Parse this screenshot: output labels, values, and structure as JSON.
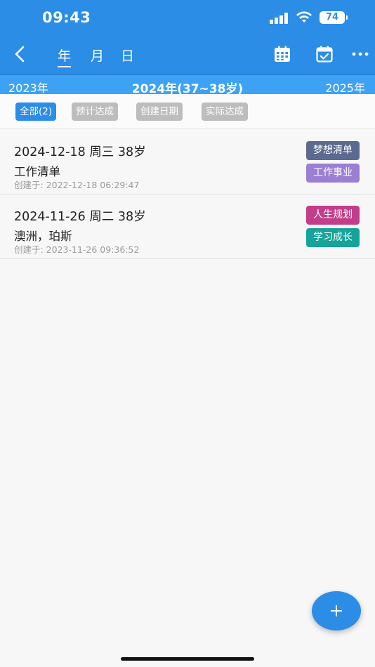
{
  "status": {
    "time": "09:43",
    "battery": "74"
  },
  "nav": {
    "tabs": [
      {
        "label": "年"
      },
      {
        "label": "月"
      },
      {
        "label": "日"
      }
    ],
    "active_tab": 0,
    "icons": [
      "back-icon",
      "calendar-grid-icon",
      "calendar-check-icon",
      "more-icon"
    ]
  },
  "yearbar": {
    "prev": "2023年",
    "current": "2024年(37~38岁)",
    "next": "2025年"
  },
  "filters": [
    {
      "label": "全部(2)",
      "active": true
    },
    {
      "label": "预计达成",
      "active": false
    },
    {
      "label": "创建日期",
      "active": false
    },
    {
      "label": "实际达成",
      "active": false
    }
  ],
  "items": [
    {
      "date": "2024-12-18 周三 38岁",
      "title": "工作清单",
      "created": "创建于: 2022-12-18 06:29:47",
      "tags": [
        {
          "label": "梦想清单",
          "color": "#5b6a8e"
        },
        {
          "label": "工作事业",
          "color": "#9b7fd3"
        }
      ]
    },
    {
      "date": "2024-11-26 周二 38岁",
      "title": "澳洲，珀斯",
      "created": "创建于: 2023-11-26 09:36:52",
      "tags": [
        {
          "label": "人生规划",
          "color": "#c23e8a"
        },
        {
          "label": "学习成长",
          "color": "#15a39a"
        }
      ]
    }
  ],
  "colors": {
    "primary": "#2b8de6",
    "yearbar": "#3da2f4",
    "chip_inactive": "#bdbdbd"
  },
  "fab": {
    "icon": "plus-icon"
  }
}
